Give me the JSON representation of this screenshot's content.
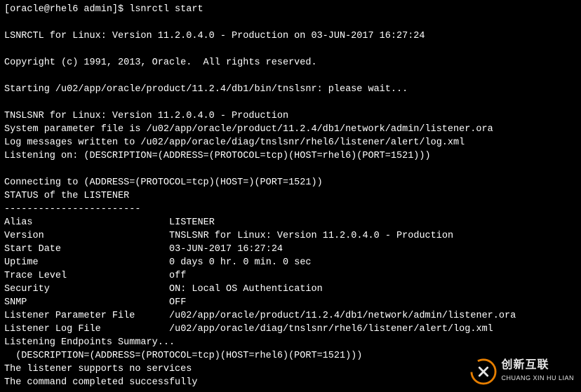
{
  "prompt": "[oracle@rhel6 admin]$ lsnrctl start",
  "header": {
    "banner": "LSNRCTL for Linux: Version 11.2.0.4.0 - Production on 03-JUN-2017 16:27:24",
    "copyright": "Copyright (c) 1991, 2013, Oracle.  All rights reserved.",
    "starting": "Starting /u02/app/oracle/product/11.2.4/db1/bin/tnslsnr: please wait..."
  },
  "startup": {
    "tnslsnr_banner": "TNSLSNR for Linux: Version 11.2.0.4.0 - Production",
    "param_file": "System parameter file is /u02/app/oracle/product/11.2.4/db1/network/admin/listener.ora",
    "log_messages": "Log messages written to /u02/app/oracle/diag/tnslsnr/rhel6/listener/alert/log.xml",
    "listening_on": "Listening on: (DESCRIPTION=(ADDRESS=(PROTOCOL=tcp)(HOST=rhel6)(PORT=1521)))"
  },
  "connecting": "Connecting to (ADDRESS=(PROTOCOL=tcp)(HOST=)(PORT=1521))",
  "status_title": "STATUS of the LISTENER",
  "divider": "------------------------",
  "status": {
    "alias": {
      "label": "Alias",
      "value": "LISTENER"
    },
    "version": {
      "label": "Version",
      "value": "TNSLSNR for Linux: Version 11.2.0.4.0 - Production"
    },
    "start_date": {
      "label": "Start Date",
      "value": "03-JUN-2017 16:27:24"
    },
    "uptime": {
      "label": "Uptime",
      "value": "0 days 0 hr. 0 min. 0 sec"
    },
    "trace_level": {
      "label": "Trace Level",
      "value": "off"
    },
    "security": {
      "label": "Security",
      "value": "ON: Local OS Authentication"
    },
    "snmp": {
      "label": "SNMP",
      "value": "OFF"
    },
    "param_file": {
      "label": "Listener Parameter File",
      "value": "/u02/app/oracle/product/11.2.4/db1/network/admin/listener.ora"
    },
    "log_file": {
      "label": "Listener Log File",
      "value": "/u02/app/oracle/diag/tnslsnr/rhel6/listener/alert/log.xml"
    }
  },
  "endpoints": {
    "title": "Listening Endpoints Summary...",
    "description": "  (DESCRIPTION=(ADDRESS=(PROTOCOL=tcp)(HOST=rhel6)(PORT=1521)))"
  },
  "footer": {
    "no_services": "The listener supports no services",
    "completed": "The command completed successfully"
  },
  "watermark": {
    "main": "创新互联",
    "sub": "CHUANG XIN HU LIAN"
  }
}
